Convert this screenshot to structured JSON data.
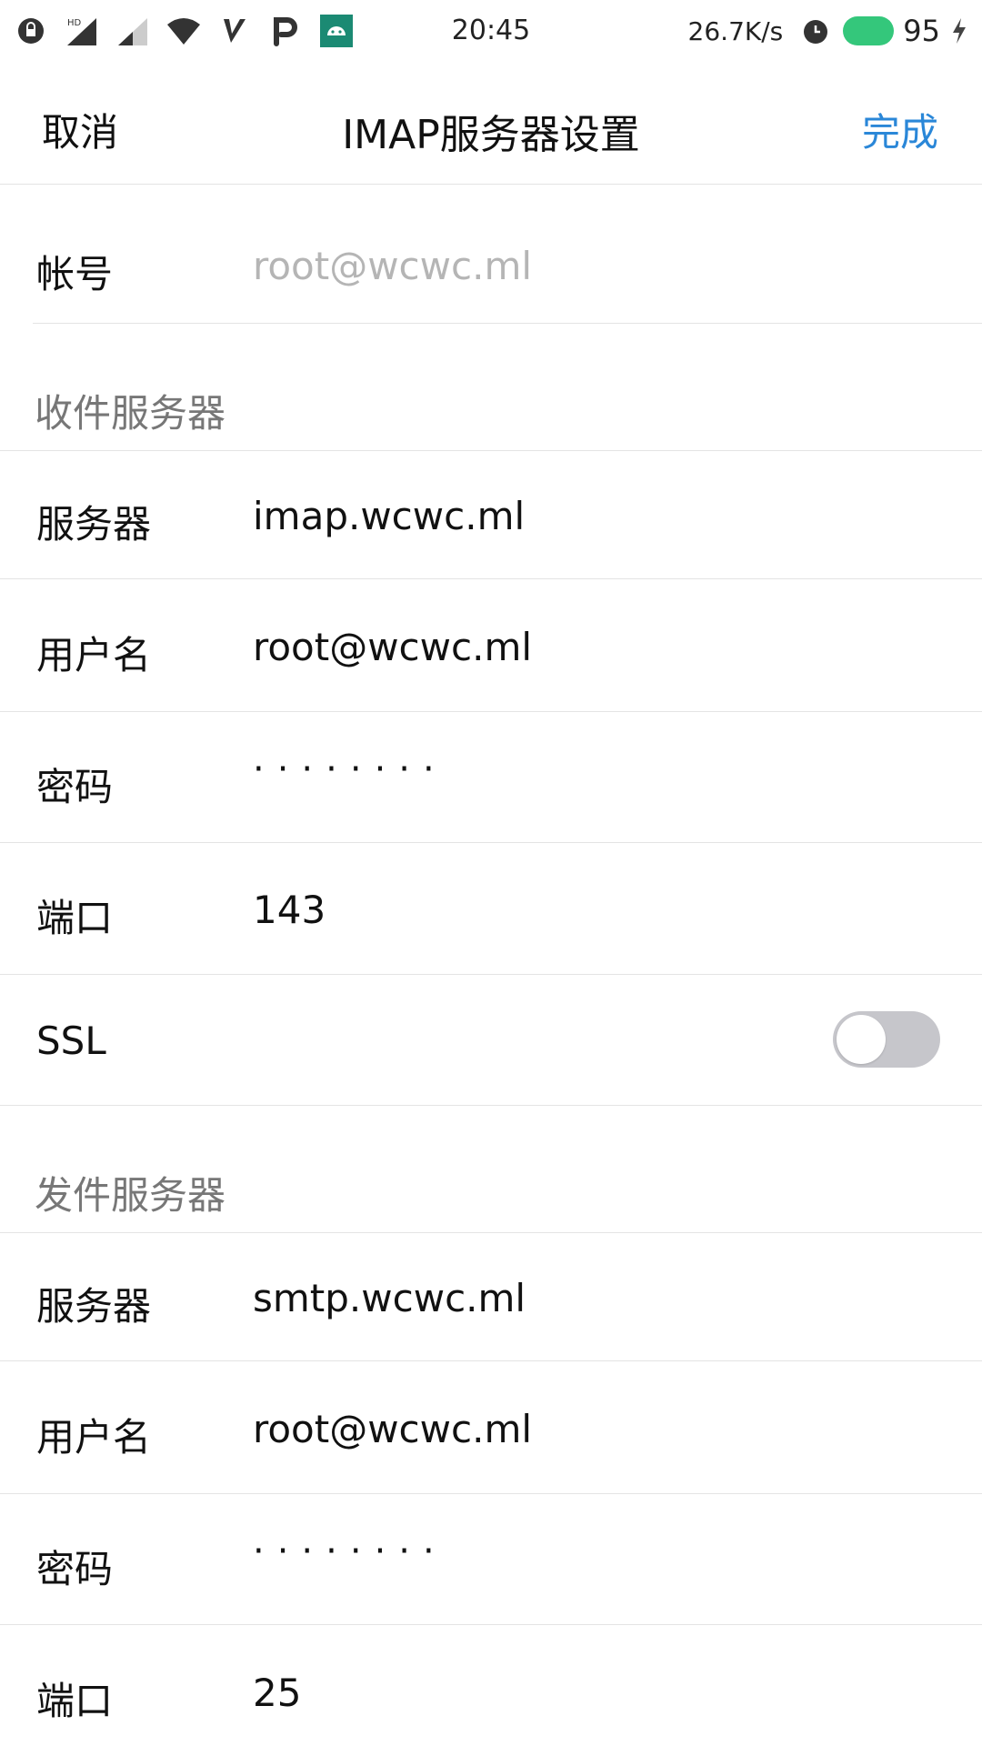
{
  "status_bar": {
    "time": "20:45",
    "net_speed": "26.7K/s",
    "battery_level": "95",
    "icons_left": [
      "lock-icon",
      "hd-signal-icon",
      "signal-icon",
      "wifi-icon",
      "v-app-icon",
      "p-app-icon",
      "android-icon"
    ],
    "icons_right": [
      "alarm-icon",
      "battery-icon",
      "charging-icon"
    ],
    "battery_color": "#34c77b"
  },
  "nav": {
    "cancel_label": "取消",
    "title": "IMAP服务器设置",
    "done_label": "完成",
    "accent_color": "#2a87d8"
  },
  "account": {
    "label": "帐号",
    "placeholder": "root@wcwc.ml"
  },
  "incoming": {
    "section_title": "收件服务器",
    "server_label": "服务器",
    "server_value": "imap.wcwc.ml",
    "username_label": "用户名",
    "username_value": "root@wcwc.ml",
    "password_label": "密码",
    "password_value": "········",
    "port_label": "端口",
    "port_value": "143",
    "ssl_label": "SSL",
    "ssl_enabled": false
  },
  "outgoing": {
    "section_title": "发件服务器",
    "server_label": "服务器",
    "server_value": "smtp.wcwc.ml",
    "username_label": "用户名",
    "username_value": "root@wcwc.ml",
    "password_label": "密码",
    "password_value": "········",
    "port_label": "端口",
    "port_value": "25"
  }
}
